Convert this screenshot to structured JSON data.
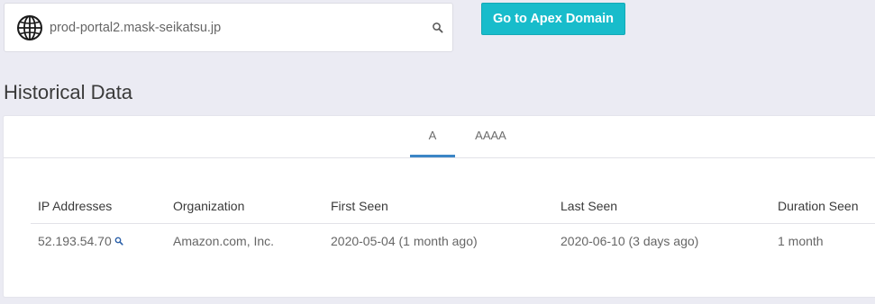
{
  "search": {
    "value": "prod-portal2.mask-seikatsu.jp",
    "globe_icon": "globe-icon",
    "search_icon": "search-icon"
  },
  "actions": {
    "apex_button_label": "Go to Apex Domain"
  },
  "section": {
    "title": "Historical Data"
  },
  "tabs": [
    {
      "label": "A",
      "active": true
    },
    {
      "label": "AAAA",
      "active": false
    }
  ],
  "table": {
    "columns": [
      "IP Addresses",
      "Organization",
      "First Seen",
      "Last Seen",
      "Duration Seen"
    ],
    "rows": [
      {
        "ip": "52.193.54.70",
        "organization": "Amazon.com, Inc.",
        "first_seen": "2020-05-04 (1 month ago)",
        "last_seen": "2020-06-10 (3 days ago)",
        "duration": "1 month"
      }
    ]
  },
  "colors": {
    "accent": "#18bccb",
    "tab_active": "#3b86c6",
    "background": "#ebebf3"
  }
}
